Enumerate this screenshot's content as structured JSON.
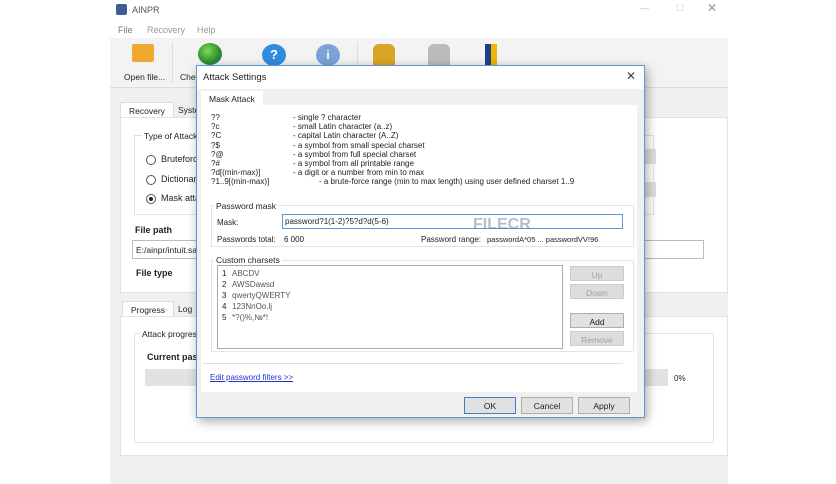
{
  "app": {
    "title": "AINPR",
    "menu": [
      "File",
      "Recovery",
      "Help"
    ],
    "window_controls": [
      "minimize",
      "maximize",
      "close"
    ],
    "toolbar": [
      {
        "label": "Open file...",
        "icon": "open-folder-icon"
      },
      {
        "label": "Chec",
        "icon": "globe-icon"
      },
      {
        "label": "",
        "icon": "help-icon"
      },
      {
        "label": "",
        "icon": "info-icon"
      },
      {
        "label": "",
        "icon": "run-attack-icon"
      },
      {
        "label": "",
        "icon": "stop-attack-icon"
      },
      {
        "label": "",
        "icon": "exit-door-icon"
      }
    ],
    "top_tabs": [
      "Recovery",
      "Syste"
    ],
    "type_of_attack": {
      "label": "Type of Attack",
      "options": [
        "Bruteforce",
        "Dictionary",
        "Mask attac"
      ],
      "selected": 2
    },
    "file_path": {
      "label": "File path",
      "value": "E:/ainpr/intuit.sa"
    },
    "file_type": {
      "label": "File type"
    },
    "bottom_tabs": [
      "Progress",
      "Log"
    ],
    "attack_progress": {
      "label": "Attack progress",
      "current_label": "Current pass",
      "percent_text": "0%",
      "percent": 0
    }
  },
  "dialog": {
    "title": "Attack Settings",
    "tab": "Mask Attack",
    "legend": [
      {
        "code": "??",
        "desc": "- single ? character"
      },
      {
        "code": "?c",
        "desc": "- small Latin character (a..z)"
      },
      {
        "code": "?C",
        "desc": "- capital Latin character (A..Z)"
      },
      {
        "code": "?$",
        "desc": "- a symbol from small special charset"
      },
      {
        "code": "?@",
        "desc": "- a symbol from full special charset"
      },
      {
        "code": "?#",
        "desc": "- a symbol from all printable range"
      },
      {
        "code": "?d[(min-max)]",
        "desc": "- a digit or a number from min to max"
      },
      {
        "code": "?1..9[(min-max)]",
        "desc": "- a brute-force range (min to max length) using user defined charset 1..9"
      }
    ],
    "password_mask": {
      "group": "Password mask",
      "mask_label": "Mask:",
      "mask_value": "password?1(1-2)?5?d?d(5-6)",
      "total_label": "Passwords total:",
      "total_value": "6 000",
      "range_label": "Password range:",
      "range_value": "passwordA*05 ... passwordVV!96"
    },
    "custom_charsets": {
      "group": "Custom charsets",
      "items": [
        {
          "n": "1",
          "v": "ABCDV"
        },
        {
          "n": "2",
          "v": "AWSDawsd"
        },
        {
          "n": "3",
          "v": "qwertyQWERTY"
        },
        {
          "n": "4",
          "v": "123NnOo.lj"
        },
        {
          "n": "5",
          "v": "*?()%,№*!"
        }
      ],
      "buttons": {
        "up": "Up",
        "down": "Down",
        "add": "Add",
        "remove": "Remove"
      }
    },
    "filters_link": "Edit password filters >>",
    "ok": "OK",
    "cancel": "Cancel",
    "apply": "Apply"
  },
  "watermark": "FILECR"
}
